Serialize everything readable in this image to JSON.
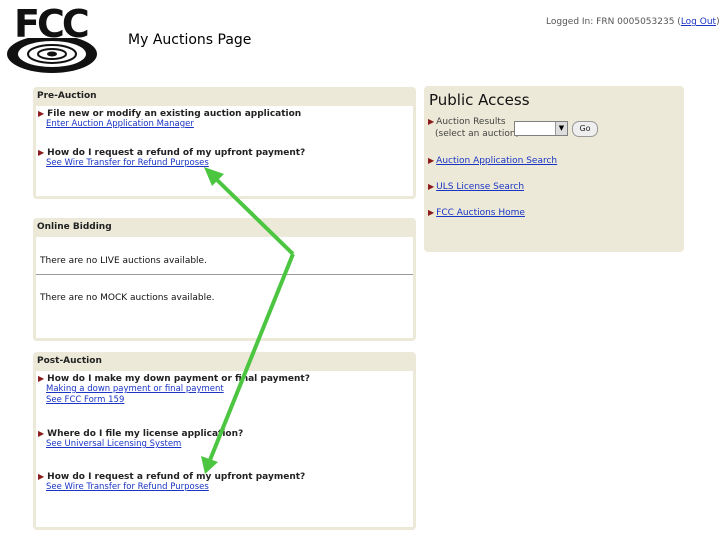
{
  "header": {
    "logo_text": "FCC",
    "page_title": "My Auctions Page",
    "login_text": "Logged In: FRN 0005053235 (",
    "logout_label": "Log Out",
    "login_close": ")"
  },
  "pre_auction": {
    "title": "Pre-Auction",
    "items": [
      {
        "question": "File new or modify an existing auction application",
        "link": "Enter Auction Application Manager"
      },
      {
        "question": "How do I request a refund of my upfront payment?",
        "link": "See Wire Transfer for Refund Purposes"
      }
    ]
  },
  "online_bidding": {
    "title": "Online Bidding",
    "live_text": "There are no LIVE auctions available.",
    "mock_text": "There are no MOCK auctions available."
  },
  "post_auction": {
    "title": "Post-Auction",
    "items": [
      {
        "question": "How do I make my down payment or final payment?",
        "links": [
          "Making a down payment or final payment",
          "See FCC Form 159"
        ]
      },
      {
        "question": "Where do I file my license application?",
        "links": [
          "See Universal Licensing System"
        ]
      },
      {
        "question": "How do I request a refund of my upfront payment?",
        "links": [
          "See Wire Transfer for Refund Purposes"
        ]
      }
    ]
  },
  "public_access": {
    "title": "Public Access",
    "auction_results_label": "Auction Results",
    "select_hint": "(select an auction)",
    "go_label": "Go",
    "links": [
      "Auction Application Search",
      "ULS License Search",
      "FCC Auctions Home"
    ]
  },
  "colors": {
    "panel_bg": "#ece9d8",
    "link": "#1a35c4",
    "annotation_arrow": "#4cc640"
  }
}
